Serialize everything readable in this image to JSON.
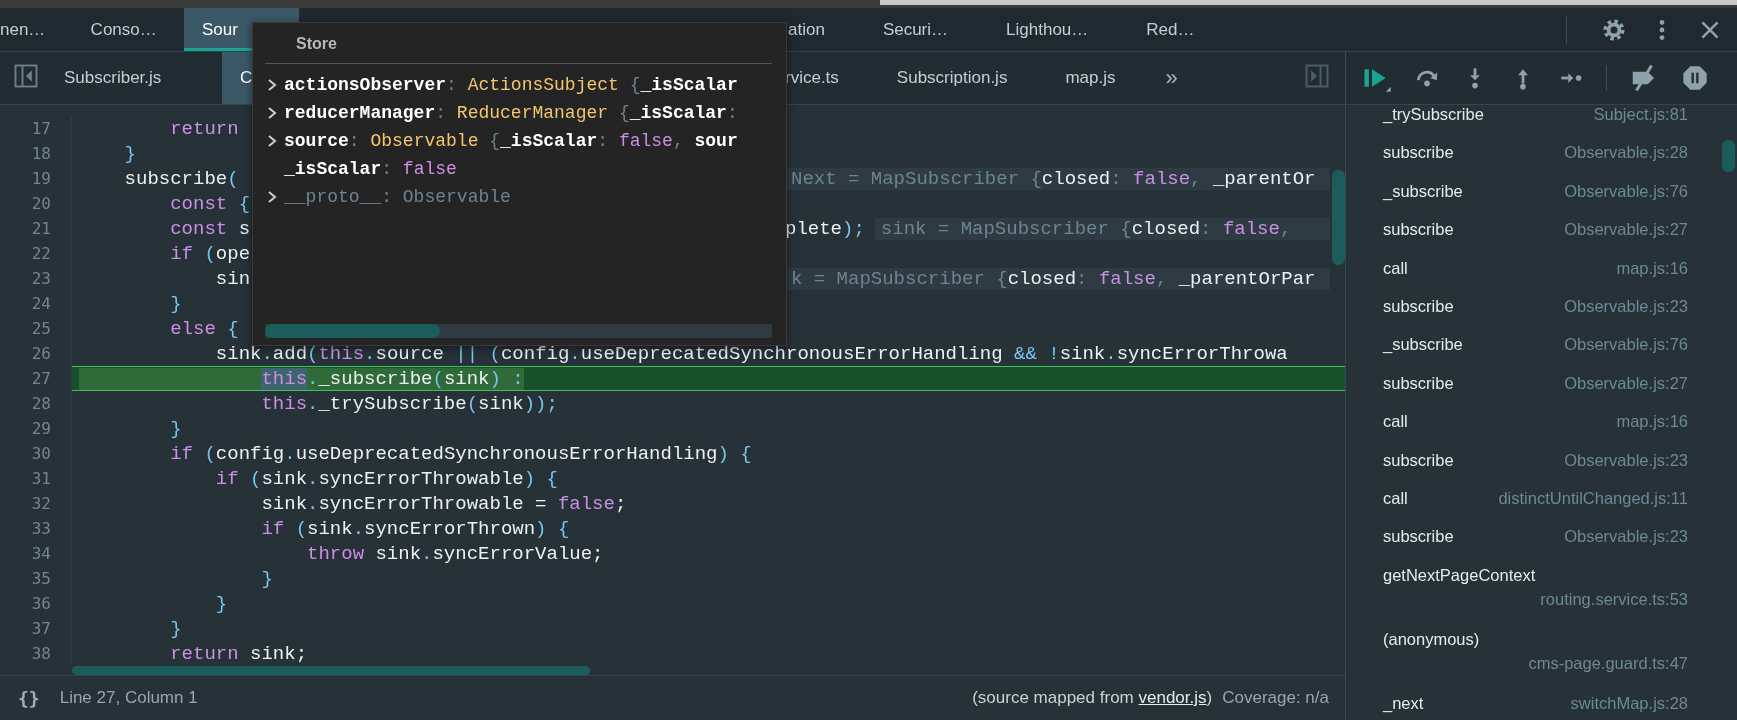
{
  "top_tabs": [
    {
      "label": "nen…",
      "selected": false
    },
    {
      "label": "Conso…",
      "selected": false
    },
    {
      "label": "Sour",
      "selected": true
    },
    {
      "label": "ation",
      "selected": false
    },
    {
      "label": "Securi…",
      "selected": false
    },
    {
      "label": "Lighthou…",
      "selected": false
    },
    {
      "label": "Red…",
      "selected": false
    }
  ],
  "file_tabs": [
    {
      "label": "Subscriber.js",
      "selected": false
    },
    {
      "label": "C",
      "selected": true
    },
    {
      "label": "rvice.ts",
      "selected": false
    },
    {
      "label": "Subscription.js",
      "selected": false
    },
    {
      "label": "map.js",
      "selected": false
    }
  ],
  "more_tabs": "»",
  "editor": {
    "lines": [
      {
        "number": "17",
        "current": false,
        "kind": "full",
        "tokens": [
          {
            "kind": "kw",
            "text": "        return"
          }
        ]
      },
      {
        "number": "18",
        "current": false,
        "kind": "full",
        "tokens": [
          {
            "kind": "p",
            "text": "    }"
          }
        ]
      },
      {
        "number": "19",
        "current": false,
        "kind": "split",
        "tokens": [
          {
            "kind": "id",
            "text": "    subscribe"
          },
          {
            "kind": "p",
            "text": "("
          }
        ],
        "inline": [
          {
            "kind": "dim",
            "text": "Next = MapSubscriber {"
          },
          {
            "kind": "id",
            "text": "closed"
          },
          {
            "kind": "dim",
            "text": ": "
          },
          {
            "kind": "kw",
            "text": "false"
          },
          {
            "kind": "dim",
            "text": ", "
          },
          {
            "kind": "id",
            "text": "_parentOr"
          }
        ]
      },
      {
        "number": "20",
        "current": false,
        "kind": "full",
        "tokens": [
          {
            "kind": "kw",
            "text": "        const "
          },
          {
            "kind": "p",
            "text": "{"
          }
        ]
      },
      {
        "number": "21",
        "current": false,
        "kind": "split",
        "tokens": [
          {
            "kind": "kw",
            "text": "        const "
          },
          {
            "kind": "id",
            "text": "s"
          }
        ],
        "right": [
          {
            "kind": "id",
            "text": "plete"
          },
          {
            "kind": "p",
            "text": ");"
          }
        ],
        "inline": [
          {
            "kind": "dim",
            "text": "sink = MapSubscriber {"
          },
          {
            "kind": "id",
            "text": "closed"
          },
          {
            "kind": "dim",
            "text": ": "
          },
          {
            "kind": "kw",
            "text": "false"
          },
          {
            "kind": "dim",
            "text": ","
          }
        ]
      },
      {
        "number": "22",
        "current": false,
        "kind": "full",
        "tokens": [
          {
            "kind": "kw",
            "text": "        if "
          },
          {
            "kind": "p",
            "text": "("
          },
          {
            "kind": "id",
            "text": "ope"
          }
        ]
      },
      {
        "number": "23",
        "current": false,
        "kind": "split",
        "tokens": [
          {
            "kind": "id",
            "text": "            sin"
          }
        ],
        "inline": [
          {
            "kind": "dim",
            "text": "k = MapSubscriber {"
          },
          {
            "kind": "id",
            "text": "closed"
          },
          {
            "kind": "dim",
            "text": ": "
          },
          {
            "kind": "kw",
            "text": "false"
          },
          {
            "kind": "dim",
            "text": ", "
          },
          {
            "kind": "id",
            "text": "_parentOrPar"
          }
        ]
      },
      {
        "number": "24",
        "current": false,
        "kind": "full",
        "tokens": [
          {
            "kind": "p",
            "text": "        }"
          }
        ]
      },
      {
        "number": "25",
        "current": false,
        "kind": "full",
        "tokens": [
          {
            "kind": "kw",
            "text": "        else "
          },
          {
            "kind": "p",
            "text": "{"
          }
        ]
      },
      {
        "number": "26",
        "current": false,
        "kind": "full",
        "tokens": [
          {
            "kind": "id",
            "text": "            sink"
          },
          {
            "kind": "p",
            "text": "."
          },
          {
            "kind": "id",
            "text": "add"
          },
          {
            "kind": "p",
            "text": "("
          },
          {
            "kind": "kw",
            "text": "this"
          },
          {
            "kind": "p",
            "text": "."
          },
          {
            "kind": "id",
            "text": "source "
          },
          {
            "kind": "p",
            "text": "|| ("
          },
          {
            "kind": "id",
            "text": "config"
          },
          {
            "kind": "p",
            "text": "."
          },
          {
            "kind": "id",
            "text": "useDeprecatedSynchronousErrorHandling "
          },
          {
            "kind": "p",
            "text": "&& !"
          },
          {
            "kind": "id",
            "text": "sink"
          },
          {
            "kind": "p",
            "text": "."
          },
          {
            "kind": "id",
            "text": "syncErrorThrowa"
          }
        ]
      },
      {
        "number": "27",
        "current": true,
        "kind": "full",
        "tokens": [
          {
            "kind": "hovered",
            "text": "                this"
          },
          {
            "kind": "p",
            "text": "."
          },
          {
            "kind": "id",
            "text": "_subscribe"
          },
          {
            "kind": "p",
            "text": "("
          },
          {
            "kind": "id",
            "text": "sink"
          },
          {
            "kind": "p",
            "text": ") :"
          }
        ]
      },
      {
        "number": "28",
        "current": false,
        "kind": "full",
        "tokens": [
          {
            "kind": "kw",
            "text": "                this"
          },
          {
            "kind": "p",
            "text": "."
          },
          {
            "kind": "id",
            "text": "_trySubscribe"
          },
          {
            "kind": "p",
            "text": "("
          },
          {
            "kind": "id",
            "text": "sink"
          },
          {
            "kind": "p",
            "text": "));"
          }
        ]
      },
      {
        "number": "29",
        "current": false,
        "kind": "full",
        "tokens": [
          {
            "kind": "p",
            "text": "        }"
          }
        ]
      },
      {
        "number": "30",
        "current": false,
        "kind": "full",
        "tokens": [
          {
            "kind": "kw",
            "text": "        if "
          },
          {
            "kind": "p",
            "text": "("
          },
          {
            "kind": "id",
            "text": "config"
          },
          {
            "kind": "p",
            "text": "."
          },
          {
            "kind": "id",
            "text": "useDeprecatedSynchronousErrorHandling"
          },
          {
            "kind": "p",
            "text": ") {"
          }
        ]
      },
      {
        "number": "31",
        "current": false,
        "kind": "full",
        "tokens": [
          {
            "kind": "kw",
            "text": "            if "
          },
          {
            "kind": "p",
            "text": "("
          },
          {
            "kind": "id",
            "text": "sink"
          },
          {
            "kind": "p",
            "text": "."
          },
          {
            "kind": "id",
            "text": "syncErrorThrowable"
          },
          {
            "kind": "p",
            "text": ") {"
          }
        ]
      },
      {
        "number": "32",
        "current": false,
        "kind": "full",
        "tokens": [
          {
            "kind": "id",
            "text": "                sink"
          },
          {
            "kind": "p",
            "text": "."
          },
          {
            "kind": "id",
            "text": "syncErrorThrowable = "
          },
          {
            "kind": "kw",
            "text": "false"
          },
          {
            "kind": "id",
            "text": ";"
          }
        ]
      },
      {
        "number": "33",
        "current": false,
        "kind": "full",
        "tokens": [
          {
            "kind": "kw",
            "text": "                if "
          },
          {
            "kind": "p",
            "text": "("
          },
          {
            "kind": "id",
            "text": "sink"
          },
          {
            "kind": "p",
            "text": "."
          },
          {
            "kind": "id",
            "text": "syncErrorThrown"
          },
          {
            "kind": "p",
            "text": ") {"
          }
        ]
      },
      {
        "number": "34",
        "current": false,
        "kind": "full",
        "tokens": [
          {
            "kind": "kw",
            "text": "                    throw "
          },
          {
            "kind": "id",
            "text": "sink"
          },
          {
            "kind": "p",
            "text": "."
          },
          {
            "kind": "id",
            "text": "syncErrorValue;"
          }
        ]
      },
      {
        "number": "35",
        "current": false,
        "kind": "full",
        "tokens": [
          {
            "kind": "p",
            "text": "                }"
          }
        ]
      },
      {
        "number": "36",
        "current": false,
        "kind": "full",
        "tokens": [
          {
            "kind": "p",
            "text": "            }"
          }
        ]
      },
      {
        "number": "37",
        "current": false,
        "kind": "full",
        "tokens": [
          {
            "kind": "p",
            "text": "        }"
          }
        ]
      },
      {
        "number": "38",
        "current": false,
        "kind": "full",
        "tokens": [
          {
            "kind": "kw",
            "text": "        return "
          },
          {
            "kind": "id",
            "text": "sink;"
          }
        ]
      }
    ]
  },
  "popover": {
    "title": "Store",
    "rows": [
      {
        "kind": "object",
        "tokens": [
          {
            "kind": "key",
            "text": "actionsObserver"
          },
          {
            "kind": "dim",
            "text": ": "
          },
          {
            "kind": "type",
            "text": "ActionsSubject"
          },
          {
            "kind": "dim",
            "text": " {"
          },
          {
            "kind": "key",
            "text": "_isScalar"
          }
        ]
      },
      {
        "kind": "object",
        "tokens": [
          {
            "kind": "key",
            "text": "reducerManager"
          },
          {
            "kind": "dim",
            "text": ": "
          },
          {
            "kind": "type",
            "text": "ReducerManager"
          },
          {
            "kind": "dim",
            "text": " {"
          },
          {
            "kind": "key",
            "text": "_isScalar"
          },
          {
            "kind": "dim",
            "text": ":"
          }
        ]
      },
      {
        "kind": "object",
        "tokens": [
          {
            "kind": "key",
            "text": "source"
          },
          {
            "kind": "dim",
            "text": ": "
          },
          {
            "kind": "type",
            "text": "Observable"
          },
          {
            "kind": "dim",
            "text": " {"
          },
          {
            "kind": "key",
            "text": "_isScalar"
          },
          {
            "kind": "dim",
            "text": ": "
          },
          {
            "kind": "kw",
            "text": "false"
          },
          {
            "kind": "dim",
            "text": ", "
          },
          {
            "kind": "key",
            "text": "sour"
          }
        ]
      },
      {
        "kind": "value",
        "tokens": [
          {
            "kind": "key",
            "text": "_isScalar"
          },
          {
            "kind": "dim",
            "text": ": "
          },
          {
            "kind": "kw",
            "text": "false"
          }
        ]
      },
      {
        "kind": "object",
        "tokens": [
          {
            "kind": "dim",
            "text": "__proto__: Observable"
          }
        ]
      }
    ]
  },
  "status_bar": {
    "format_button": "{}",
    "position": "Line 27, Column 1",
    "source_note": {
      "before": "(source mapped from ",
      "link": "vendor.js",
      "after": ")"
    },
    "coverage": "Coverage: n/a"
  },
  "call_stack": [
    {
      "kind": "inline",
      "function": "_trySubscribe",
      "location": "Subject.js:81"
    },
    {
      "kind": "inline",
      "function": "subscribe",
      "location": "Observable.js:28"
    },
    {
      "kind": "inline",
      "function": "_subscribe",
      "location": "Observable.js:76"
    },
    {
      "kind": "inline",
      "function": "subscribe",
      "location": "Observable.js:27"
    },
    {
      "kind": "inline",
      "function": "call",
      "location": "map.js:16"
    },
    {
      "kind": "inline",
      "function": "subscribe",
      "location": "Observable.js:23"
    },
    {
      "kind": "inline",
      "function": "_subscribe",
      "location": "Observable.js:76"
    },
    {
      "kind": "inline",
      "function": "subscribe",
      "location": "Observable.js:27"
    },
    {
      "kind": "inline",
      "function": "call",
      "location": "map.js:16"
    },
    {
      "kind": "inline",
      "function": "subscribe",
      "location": "Observable.js:23"
    },
    {
      "kind": "inline",
      "function": "call",
      "location": "distinctUntilChanged.js:11"
    },
    {
      "kind": "inline",
      "function": "subscribe",
      "location": "Observable.js:23"
    },
    {
      "kind": "wrapped",
      "function": "getNextPageContext",
      "location": "routing.service.ts:53"
    },
    {
      "kind": "wrapped",
      "function": "(anonymous)",
      "location": "cms-page.guard.ts:47"
    },
    {
      "kind": "inline",
      "function": "_next",
      "location": "switchMap.js:28"
    }
  ]
}
